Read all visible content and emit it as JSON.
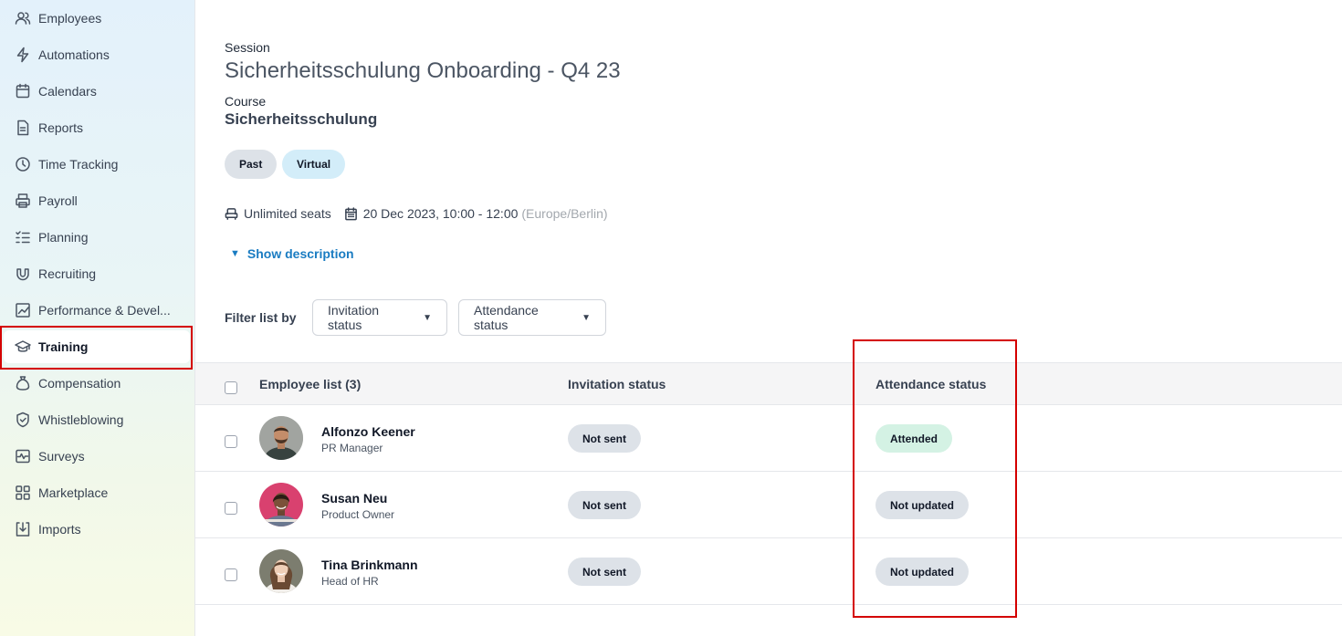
{
  "sidebar": {
    "items": [
      {
        "label": "Employees",
        "icon": "users-icon"
      },
      {
        "label": "Automations",
        "icon": "bolt-icon"
      },
      {
        "label": "Calendars",
        "icon": "calendar-icon"
      },
      {
        "label": "Reports",
        "icon": "document-icon"
      },
      {
        "label": "Time Tracking",
        "icon": "clock-icon"
      },
      {
        "label": "Payroll",
        "icon": "printer-icon"
      },
      {
        "label": "Planning",
        "icon": "list-check-icon"
      },
      {
        "label": "Recruiting",
        "icon": "magnet-icon"
      },
      {
        "label": "Performance & Devel...",
        "icon": "chart-icon"
      },
      {
        "label": "Training",
        "icon": "graduation-cap-icon",
        "active": true
      },
      {
        "label": "Compensation",
        "icon": "money-bag-icon"
      },
      {
        "label": "Whistleblowing",
        "icon": "shield-icon"
      },
      {
        "label": "Surveys",
        "icon": "pulse-icon"
      },
      {
        "label": "Marketplace",
        "icon": "grid-icon"
      },
      {
        "label": "Imports",
        "icon": "import-icon"
      }
    ]
  },
  "session": {
    "label": "Session",
    "title": "Sicherheitsschulung Onboarding - Q4 23",
    "course_label": "Course",
    "course_name": "Sicherheitsschulung",
    "tags": [
      "Past",
      "Virtual"
    ],
    "seats": "Unlimited seats",
    "datetime": "20 Dec 2023, 10:00 - 12:00",
    "timezone": "(Europe/Berlin)",
    "show_description": "Show description"
  },
  "filters": {
    "label": "Filter list by",
    "invitation": "Invitation status",
    "attendance": "Attendance status"
  },
  "table": {
    "columns": [
      "Employee list (3)",
      "Invitation status",
      "Attendance status"
    ],
    "rows": [
      {
        "name": "Alfonzo Keener",
        "role": "PR Manager",
        "invitation": "Not sent",
        "attendance": "Attended"
      },
      {
        "name": "Susan Neu",
        "role": "Product Owner",
        "invitation": "Not sent",
        "attendance": "Not updated"
      },
      {
        "name": "Tina Brinkmann",
        "role": "Head of HR",
        "invitation": "Not sent",
        "attendance": "Not updated"
      }
    ]
  },
  "colors": {
    "accent": "#1a7cc2",
    "highlight": "#d40000",
    "attended": "#d4f2e4",
    "neutral_pill": "#dde2e8"
  }
}
